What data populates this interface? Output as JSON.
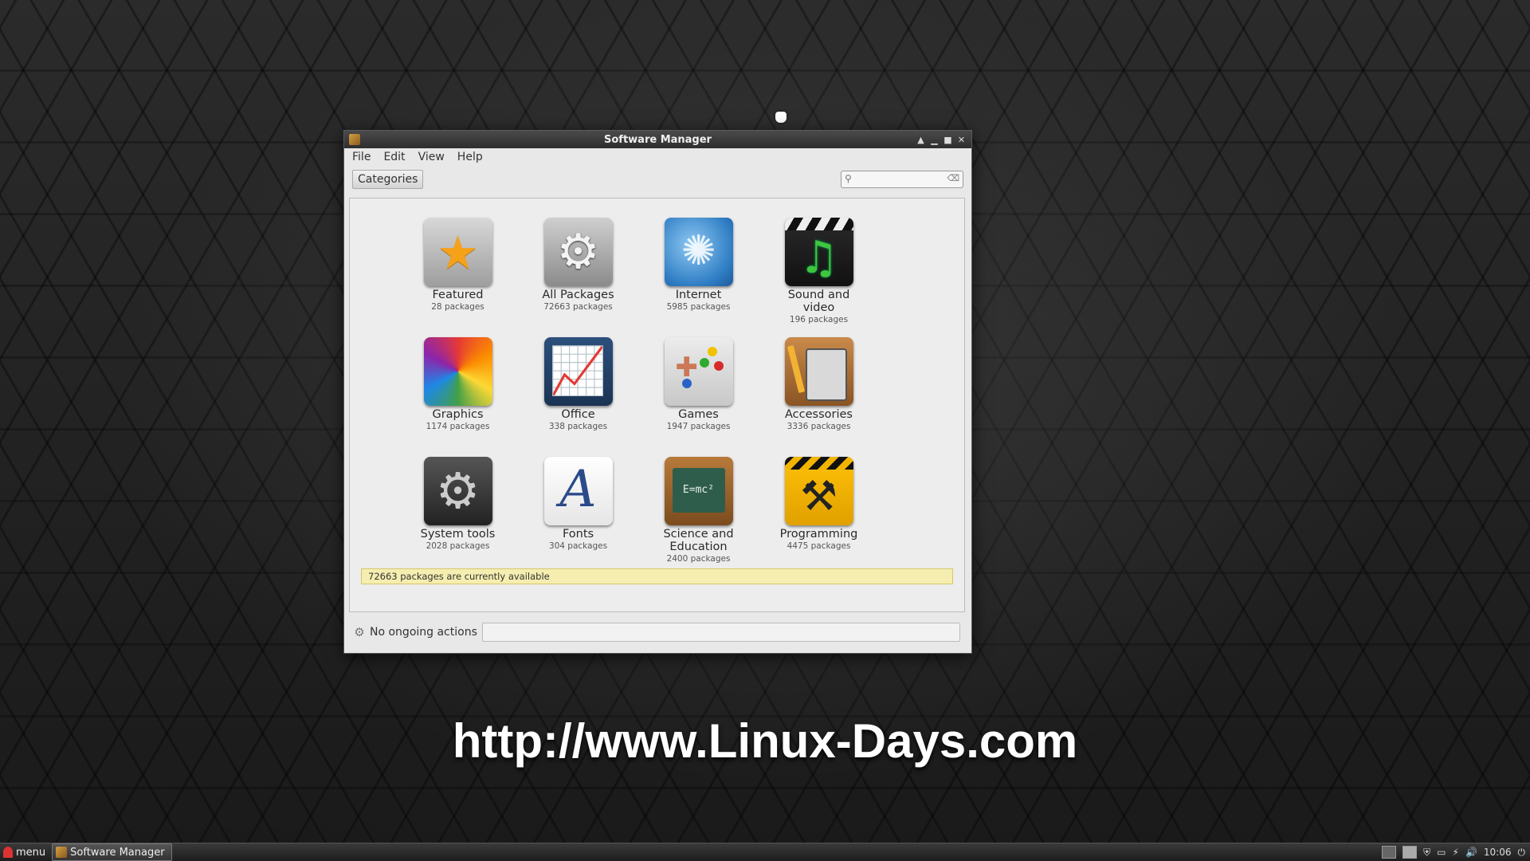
{
  "window": {
    "title": "Software Manager",
    "menu": [
      "File",
      "Edit",
      "View",
      "Help"
    ],
    "toolbar": {
      "categories_label": "Categories",
      "search_value": ""
    },
    "categories": [
      {
        "name": "Featured",
        "count": "28 packages",
        "icon": "star-icon"
      },
      {
        "name": "All Packages",
        "count": "72663 packages",
        "icon": "gear-icon"
      },
      {
        "name": "Internet",
        "count": "5985 packages",
        "icon": "globe-icon"
      },
      {
        "name": "Sound and video",
        "count": "196 packages",
        "icon": "clapperboard-note-icon"
      },
      {
        "name": "Graphics",
        "count": "1174 packages",
        "icon": "color-wheel-icon"
      },
      {
        "name": "Office",
        "count": "338 packages",
        "icon": "line-chart-icon"
      },
      {
        "name": "Games",
        "count": "1947 packages",
        "icon": "gamepad-icon"
      },
      {
        "name": "Accessories",
        "count": "3336 packages",
        "icon": "calculator-icon"
      },
      {
        "name": "System tools",
        "count": "2028 packages",
        "icon": "cogs-icon"
      },
      {
        "name": "Fonts",
        "count": "304 packages",
        "icon": "letter-a-icon"
      },
      {
        "name": "Science and Education",
        "count": "2400 packages",
        "icon": "chalkboard-icon"
      },
      {
        "name": "Programming",
        "count": "4475 packages",
        "icon": "construction-icon"
      }
    ],
    "status_strip": "72663 packages are currently available",
    "bottom": {
      "actions_label": "No ongoing actions"
    }
  },
  "watermark": "http://www.Linux-Days.com",
  "taskbar": {
    "menu_label": "menu",
    "task_label": "Software Manager",
    "clock": "10:06"
  }
}
